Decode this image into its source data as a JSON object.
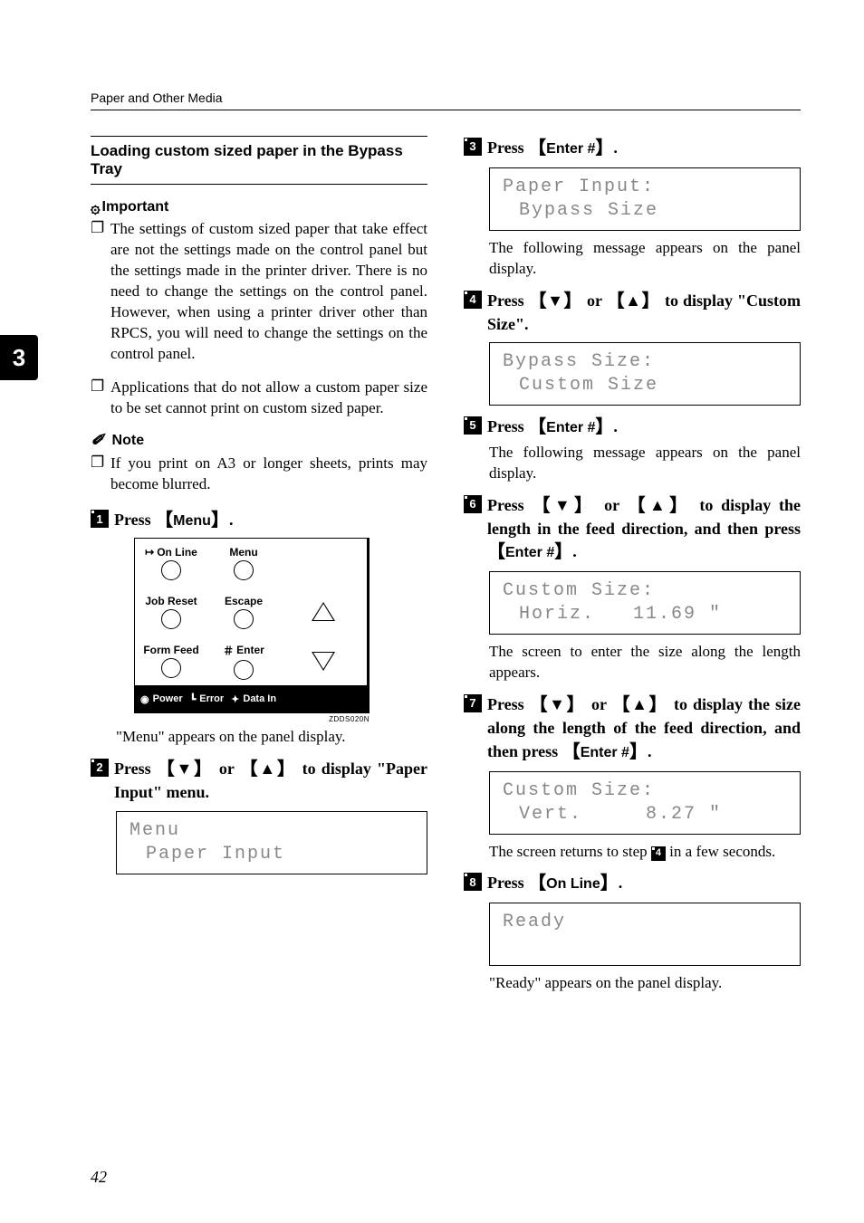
{
  "running_head": "Paper and Other Media",
  "side_tab": "3",
  "page_number": "42",
  "subsection_title": "Loading custom sized paper in the Bypass Tray",
  "important_label": "Important",
  "important_items": [
    "The settings of custom sized paper that take effect are not the settings made on the control panel but the settings made in the printer driver. There is no need to change the settings on the control panel. However, when using a printer driver other than RPCS, you will need to change the settings on the control panel.",
    "Applications that do not allow a custom paper size to be set cannot print on custom sized paper."
  ],
  "note_label": "Note",
  "note_items": [
    "If you print on A3 or longer sheets, prints may become blurred."
  ],
  "panel": {
    "online": "On Line",
    "menu": "Menu",
    "jobreset": "Job Reset",
    "escape": "Escape",
    "formfeed": "Form Feed",
    "enter": "Enter",
    "power": "Power",
    "error": "Error",
    "datain": "Data In",
    "code": "ZDDS020N"
  },
  "steps": {
    "s1": {
      "pre": "Press ",
      "key": "Menu",
      "post": "."
    },
    "s1_body": "\"Menu\" appears on the panel display.",
    "s2": {
      "pre": "Press ",
      "mid": " or ",
      "post": " to display \"Paper Input\" menu."
    },
    "s2_lcd": {
      "l1": "Menu",
      "l2": "Paper Input"
    },
    "s3": {
      "pre": "Press ",
      "key": "Enter #",
      "post": "."
    },
    "s3_lcd": {
      "l1": "Paper Input:",
      "l2": "Bypass Size"
    },
    "s3_body": "The following message appears on the panel display.",
    "s4": {
      "pre": "Press ",
      "mid": " or ",
      "post": " to display \"Custom Size\"."
    },
    "s4_lcd": {
      "l1": "Bypass Size:",
      "l2": "Custom Size"
    },
    "s5": {
      "pre": "Press ",
      "key": "Enter #",
      "post": "."
    },
    "s5_body": "The following message appears on the panel display.",
    "s6": {
      "pre": "Press ",
      "mid": " or ",
      "post1": " to display the length in the feed direction, and then press ",
      "key": "Enter #",
      "post2": "."
    },
    "s6_lcd": {
      "l1": "Custom Size:",
      "l2": "Horiz.   11.69 \""
    },
    "s6_body": "The screen to enter the size along the length appears.",
    "s7": {
      "pre": "Press ",
      "mid": " or ",
      "post1": " to display the size along the length of the feed direction, and then press ",
      "key": "Enter #",
      "post2": "."
    },
    "s7_lcd": {
      "l1": "Custom Size:",
      "l2": "Vert.     8.27 \""
    },
    "s7_body_a": "The screen returns to step ",
    "s7_body_b": " in a few seconds.",
    "s8": {
      "pre": "Press ",
      "key": "On Line",
      "post": "."
    },
    "s8_lcd": {
      "l1": "Ready",
      "l2": " "
    },
    "s8_body": "\"Ready\" appears on the panel display."
  },
  "arrows": {
    "down": "▼",
    "up": "▲"
  },
  "step_ref": "4"
}
